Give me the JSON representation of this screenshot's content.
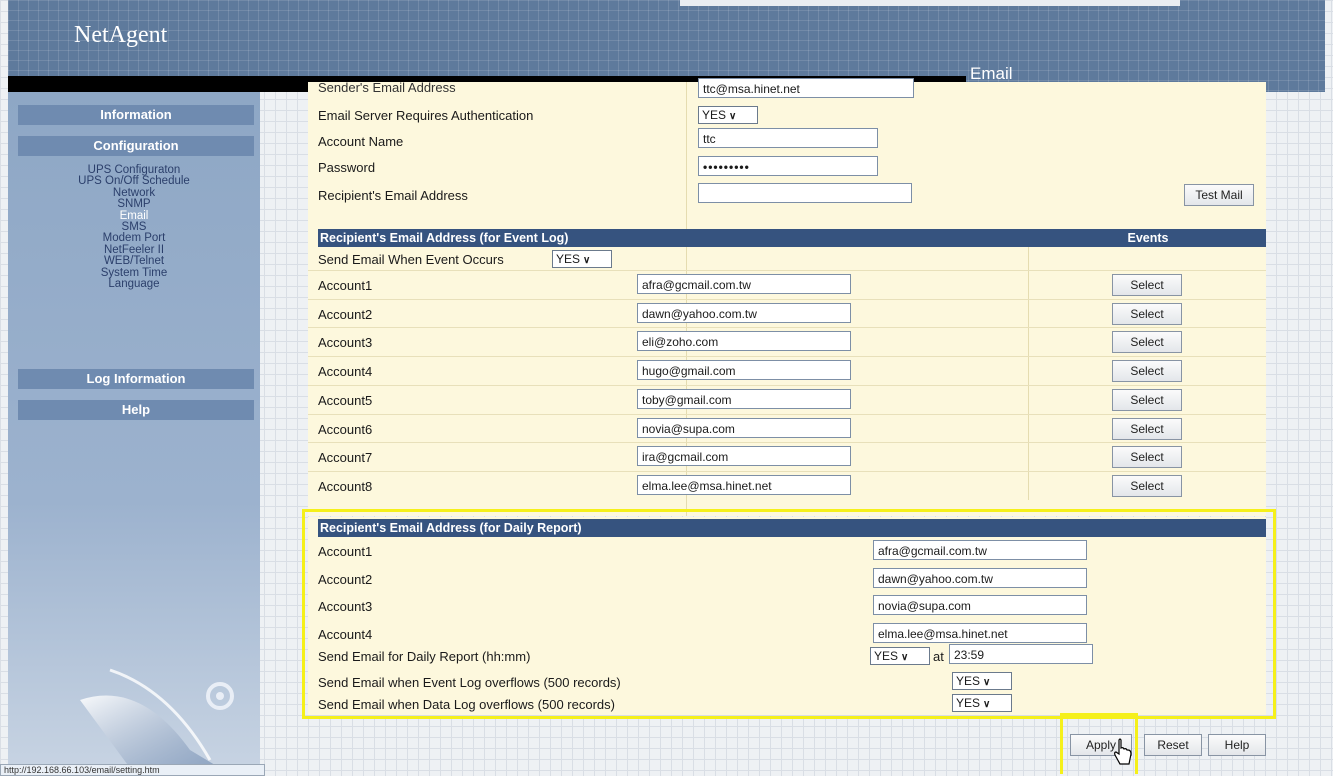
{
  "header": {
    "brand": "NetAgent",
    "page_title": "Email"
  },
  "sidebar": {
    "sections": [
      "Information",
      "Configuration",
      "Log Information",
      "Help"
    ],
    "config_links": [
      "UPS Configuraton",
      "UPS On/Off Schedule",
      "Network",
      "SNMP",
      "Email",
      "SMS",
      "Modem Port",
      "NetFeeler II",
      "WEB/Telnet",
      "System Time",
      "Language"
    ],
    "active_link": "Email"
  },
  "status_bar": {
    "url": "http://192.168.66.103/email/setting.htm"
  },
  "smtp": {
    "sender_label": "Sender's Email Address",
    "sender_value": "ttc@msa.hinet.net",
    "auth_label": "Email Server Requires Authentication",
    "auth_value": "YES",
    "account_label": "Account Name",
    "account_value": "ttc",
    "password_label": "Password",
    "password_value": "•••••••••",
    "recipient_label": "Recipient's Email Address",
    "recipient_value": "",
    "test_mail_label": "Test Mail"
  },
  "event_log": {
    "title": "Recipient's Email Address (for Event Log)",
    "events_header": "Events",
    "send_label": "Send Email When Event Occurs",
    "send_value": "YES",
    "select_label": "Select",
    "accounts": [
      {
        "label": "Account1",
        "email": "afra@gcmail.com.tw"
      },
      {
        "label": "Account2",
        "email": "dawn@yahoo.com.tw"
      },
      {
        "label": "Account3",
        "email": "eli@zoho.com"
      },
      {
        "label": "Account4",
        "email": "hugo@gmail.com"
      },
      {
        "label": "Account5",
        "email": "toby@gmail.com"
      },
      {
        "label": "Account6",
        "email": "novia@supa.com"
      },
      {
        "label": "Account7",
        "email": "ira@gcmail.com"
      },
      {
        "label": "Account8",
        "email": "elma.lee@msa.hinet.net"
      }
    ]
  },
  "daily_report": {
    "title": "Recipient's Email Address (for Daily Report)",
    "accounts": [
      {
        "label": "Account1",
        "email": "afra@gcmail.com.tw"
      },
      {
        "label": "Account2",
        "email": "dawn@yahoo.com.tw"
      },
      {
        "label": "Account3",
        "email": "novia@supa.com"
      },
      {
        "label": "Account4",
        "email": "elma.lee@msa.hinet.net"
      }
    ],
    "send_daily_label": "Send Email for Daily Report (hh:mm)",
    "send_daily_value": "YES",
    "at_label": "at",
    "time_value": "23:59",
    "event_overflow_label": "Send Email when Event Log overflows (500 records)",
    "event_overflow_value": "YES",
    "data_overflow_label": "Send Email when Data Log overflows (500 records)",
    "data_overflow_value": "YES"
  },
  "buttons": {
    "apply": "Apply",
    "reset": "Reset",
    "help": "Help"
  },
  "colors": {
    "header_bg": "#5e7a9c",
    "section_header": "#36537f",
    "form_bg": "#fdf8dd",
    "highlight": "#f5f01a"
  }
}
